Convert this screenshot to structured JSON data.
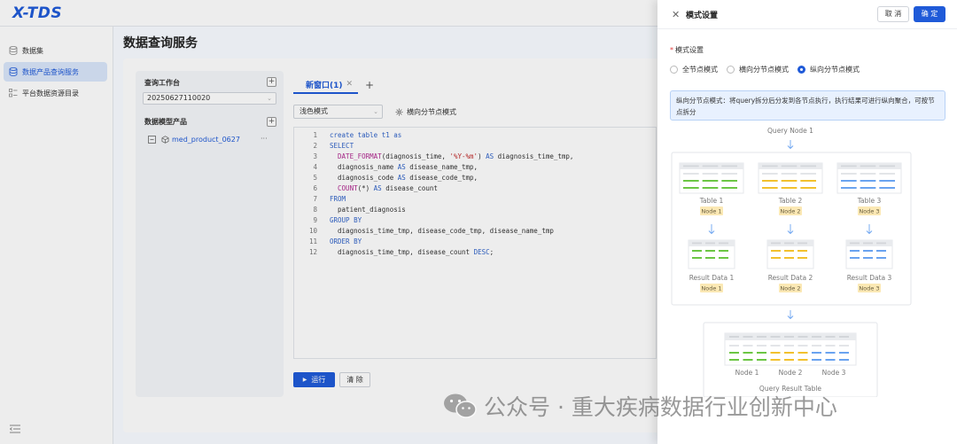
{
  "app": {
    "logo": "X-TDS"
  },
  "sidebar": {
    "items": [
      {
        "label": "数据集",
        "icon": "database-icon"
      },
      {
        "label": "数据产品查询服务",
        "icon": "database-search-icon",
        "active": true
      },
      {
        "label": "平台数据资源目录",
        "icon": "catalog-icon"
      }
    ]
  },
  "page": {
    "title": "数据查询服务"
  },
  "workbench": {
    "heading": "查询工作台",
    "selected": "20250627110020",
    "products_heading": "数据模型产品",
    "product_item": "med_product_0627",
    "more": "···"
  },
  "editor": {
    "tab_label": "新窗口(1)",
    "theme_select": "浅色模式",
    "mode_button": "横向分节点模式",
    "run_label": "运行",
    "clear_label": "清 除",
    "lines": [
      {
        "n": "1",
        "parts": [
          [
            "kw",
            "create table t1 as"
          ]
        ]
      },
      {
        "n": "2",
        "parts": [
          [
            "kw",
            "SELECT"
          ]
        ]
      },
      {
        "n": "3",
        "parts": [
          [
            "t",
            "  "
          ],
          [
            "fn",
            "DATE_FORMAT"
          ],
          [
            "t",
            "(diagnosis_time, "
          ],
          [
            "str",
            "'%Y-%m'"
          ],
          [
            "t",
            ") "
          ],
          [
            "kw",
            "AS"
          ],
          [
            "t",
            " diagnosis_time_tmp,"
          ]
        ]
      },
      {
        "n": "4",
        "parts": [
          [
            "t",
            "  diagnosis_name "
          ],
          [
            "kw",
            "AS"
          ],
          [
            "t",
            " disease_name_tmp,"
          ]
        ]
      },
      {
        "n": "5",
        "parts": [
          [
            "t",
            "  diagnosis_code "
          ],
          [
            "kw",
            "AS"
          ],
          [
            "t",
            " disease_code_tmp,"
          ]
        ]
      },
      {
        "n": "6",
        "parts": [
          [
            "t",
            "  "
          ],
          [
            "fn",
            "COUNT"
          ],
          [
            "t",
            "(*) "
          ],
          [
            "kw",
            "AS"
          ],
          [
            "t",
            " disease_count"
          ]
        ]
      },
      {
        "n": "7",
        "parts": [
          [
            "kw",
            "FROM"
          ]
        ]
      },
      {
        "n": "8",
        "parts": [
          [
            "t",
            "  patient_diagnosis"
          ]
        ]
      },
      {
        "n": "9",
        "parts": [
          [
            "kw",
            "GROUP BY"
          ]
        ]
      },
      {
        "n": "10",
        "parts": [
          [
            "t",
            "  diagnosis_time_tmp, disease_code_tmp, disease_name_tmp"
          ]
        ]
      },
      {
        "n": "11",
        "parts": [
          [
            "kw",
            "ORDER BY"
          ]
        ]
      },
      {
        "n": "12",
        "parts": [
          [
            "t",
            "  diagnosis_time_tmp, disease_count "
          ],
          [
            "kw",
            "DESC"
          ],
          [
            "t",
            ";"
          ]
        ]
      }
    ]
  },
  "drawer": {
    "title": "模式设置",
    "cancel": "取 消",
    "confirm": "确 定",
    "field_label": "模式设置",
    "options": [
      {
        "label": "全节点模式",
        "checked": false
      },
      {
        "label": "横向分节点模式",
        "checked": false
      },
      {
        "label": "纵向分节点模式",
        "checked": true
      }
    ],
    "info": "纵向分节点模式：将query拆分后分发到各节点执行，执行结果可进行纵向聚合，可按节点拆分",
    "diagram": {
      "query_node": "Query Node 1",
      "tables": [
        {
          "name": "Table 1",
          "node": "Node 1",
          "color": "#6cc644"
        },
        {
          "name": "Table 2",
          "node": "Node 2",
          "color": "#f2c12e"
        },
        {
          "name": "Table 3",
          "node": "Node 3",
          "color": "#6aa3f0"
        }
      ],
      "results": [
        "Result Data 1",
        "Result Data 2",
        "Result Data 3"
      ],
      "final_nodes": [
        "Node 1",
        "Node 2",
        "Node 3"
      ],
      "final_label": "Query Result Table"
    }
  },
  "watermark": "公众号 · 重大疾病数据行业创新中心"
}
